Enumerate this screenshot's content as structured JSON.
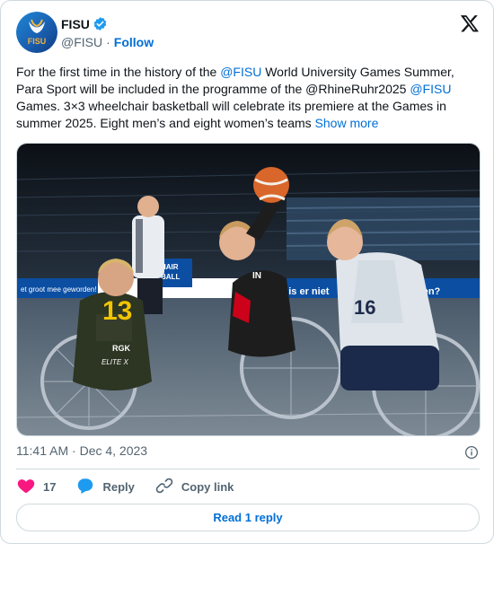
{
  "account": {
    "display_name": "FISU",
    "handle": "@FISU",
    "separator": "·",
    "follow_label": "Follow",
    "avatar_logo_text": "FISU"
  },
  "tweet": {
    "segments": [
      {
        "text": "For the first time in the history of the ",
        "link": false
      },
      {
        "text": "@FISU",
        "link": true
      },
      {
        "text": "  World University Games Summer, Para Sport will be included in the programme of the @RhineRuhr2025 ",
        "link": false
      },
      {
        "text": "@FISU",
        "link": true
      },
      {
        "text": " Games. 3×3 wheelchair basketball will celebrate its premiere at the Games in summer 2025. Eight men’s and eight women’s teams ",
        "link": false
      },
      {
        "text": "Show more",
        "link": true
      }
    ],
    "image_overlay": {
      "jersey_number_front": "13",
      "jersey_brand": "RGK",
      "jersey_brand2": "ELITE X",
      "jersey_number_right": "16",
      "banner_left": "et groot mee geworden!",
      "banner_right": "ie is er niet",
      "banner_right2": "den?",
      "sign_left": "HAIR",
      "sign_left2": "BALL",
      "player_shirt_text": "IN"
    }
  },
  "meta": {
    "time": "11:41 AM",
    "separator": "·",
    "date": "Dec 4, 2023"
  },
  "actions": {
    "like_count": "17",
    "reply_label": "Reply",
    "copy_label": "Copy link"
  },
  "footer": {
    "read_reply_label": "Read 1 reply"
  },
  "colors": {
    "link": "#006fd6",
    "heart": "#f91880",
    "reply_bubble": "#1d9bf0",
    "verified": "#1d9bf0",
    "border": "#cfd9de"
  }
}
